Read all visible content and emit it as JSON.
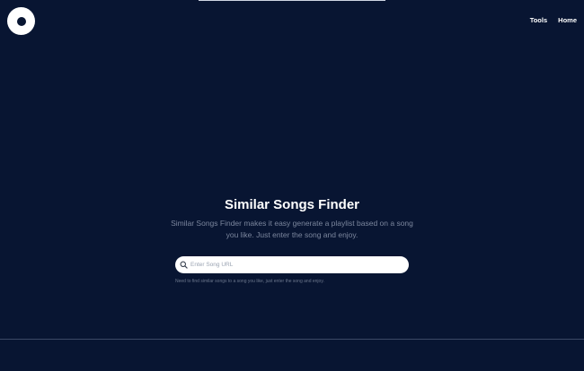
{
  "nav": {
    "tools_label": "Tools",
    "home_label": "Home"
  },
  "hero": {
    "title": "Similar Songs Finder",
    "description": "Similar Songs Finder makes it easy generate a playlist based on a song you like. Just enter the song and enjoy."
  },
  "search": {
    "placeholder": "Enter Song URL",
    "value": "",
    "icon": "search-icon"
  },
  "helper_text": "Need to find similar songs to a song you like, just enter the song and enjoy.",
  "colors": {
    "background": "#081532",
    "text": "#ffffff",
    "muted": "#7b869d"
  }
}
